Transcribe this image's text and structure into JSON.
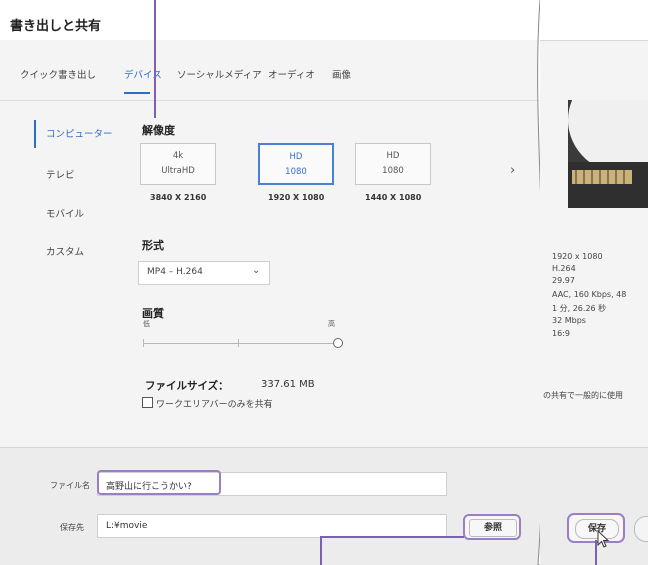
{
  "dialog": {
    "title": "書き出しと共有",
    "tabs": [
      {
        "label": "クイック書き出し"
      },
      {
        "label": "デバイス"
      },
      {
        "label": "ソーシャルメディア"
      },
      {
        "label": "オーディオ"
      },
      {
        "label": "画像"
      }
    ],
    "sidebar": [
      {
        "label": "コンピューター"
      },
      {
        "label": "テレビ"
      },
      {
        "label": "モバイル"
      },
      {
        "label": "カスタム"
      }
    ],
    "resolution": {
      "label": "解像度",
      "options": [
        {
          "line1": "4k",
          "line2": "UltraHD",
          "dims": "3840 X 2160"
        },
        {
          "line1": "HD",
          "line2": "1080",
          "dims": "1920 X 1080"
        },
        {
          "line1": "HD",
          "line2": "1080",
          "dims": "1440 X 1080"
        }
      ]
    },
    "format": {
      "label": "形式",
      "value": "MP4 – H.264"
    },
    "quality": {
      "label": "画質",
      "low": "低",
      "high": "高"
    },
    "filesize": {
      "label": "ファイルサイズ：",
      "value": "337.61 MB"
    },
    "workarea": {
      "label": "ワークエリアバーのみを共有"
    },
    "filename": {
      "label": "ファイル名",
      "value": "高野山に行こうかい?"
    },
    "saveto": {
      "label": "保存先",
      "value": "L:¥movie"
    },
    "browse_label": "参照"
  },
  "right_panel": {
    "specs": [
      "1920 x 1080",
      "H.264",
      "29.97",
      "AAC, 160 Kbps, 48",
      "1 分, 26.26 秒",
      "32 Mbps",
      "16:9"
    ],
    "note": "の共有で一般的に使用",
    "save_label": "保存"
  },
  "colors": {
    "accent": "#2e6cc9",
    "callout": "#9b7fc6"
  }
}
